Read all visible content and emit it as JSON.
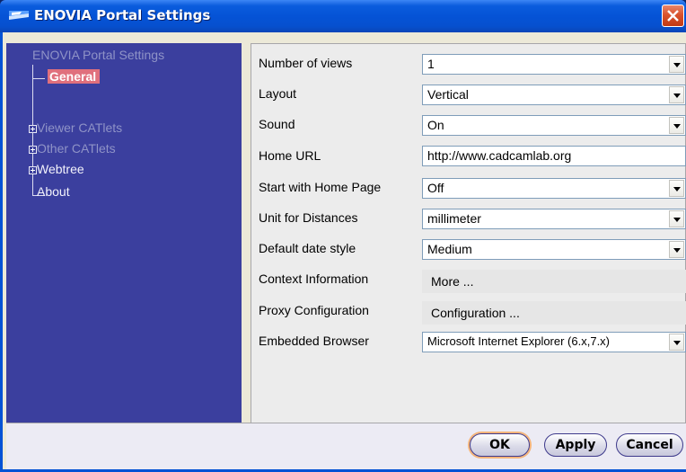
{
  "window": {
    "title": "ENOVIA Portal Settings",
    "icon": "enovia-logo-icon",
    "close_icon": "close-icon"
  },
  "tree": {
    "root": "ENOVIA Portal Settings",
    "items": [
      {
        "label": "General",
        "selected": true,
        "expandable": false
      },
      {
        "label": "Viewer CATlets",
        "selected": false,
        "expandable": true
      },
      {
        "label": "Other CATlets",
        "selected": false,
        "expandable": true
      },
      {
        "label": "Webtree",
        "selected": false,
        "expandable": true
      },
      {
        "label": "About",
        "selected": false,
        "expandable": false
      }
    ]
  },
  "settings": {
    "number_of_views": {
      "label": "Number of views",
      "value": "1"
    },
    "layout": {
      "label": "Layout",
      "value": "Vertical"
    },
    "sound": {
      "label": "Sound",
      "value": "On"
    },
    "home_url": {
      "label": "Home URL",
      "value": "http://www.cadcamlab.org"
    },
    "start_home": {
      "label": "Start with Home Page",
      "value": "Off"
    },
    "unit_distances": {
      "label": "Unit for Distances",
      "value": "millimeter"
    },
    "date_style": {
      "label": "Default date style",
      "value": "Medium"
    },
    "context_info": {
      "label": "Context Information",
      "button": "More ..."
    },
    "proxy_config": {
      "label": "Proxy Configuration",
      "button": "Configuration ..."
    },
    "embedded_browser": {
      "label": "Embedded Browser",
      "value": "Microsoft Internet Explorer (6.x,7.x)"
    }
  },
  "buttons": {
    "ok": "OK",
    "apply": "Apply",
    "cancel": "Cancel"
  },
  "colors": {
    "titlebar": "#0553d6",
    "tree_bg": "#3b3f9e",
    "selection": "#e0707d",
    "close": "#d9532d"
  }
}
